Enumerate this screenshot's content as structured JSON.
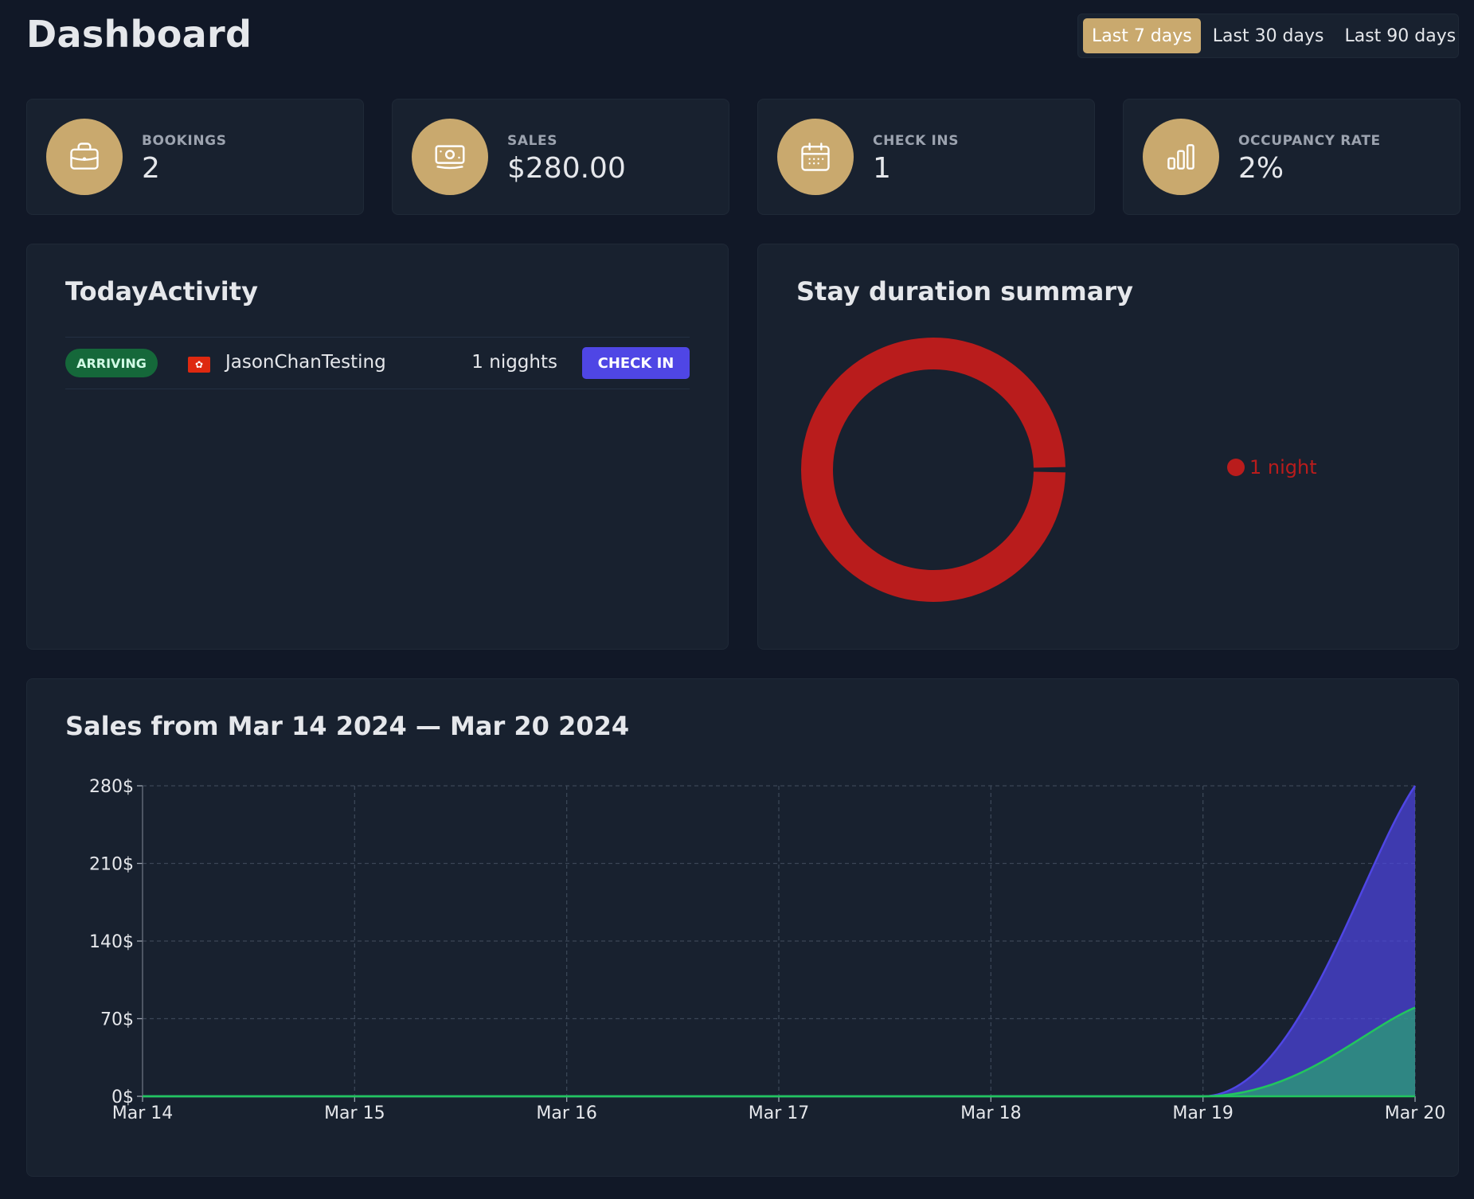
{
  "header": {
    "title": "Dashboard"
  },
  "filters": [
    {
      "label": "Last 7 days",
      "active": true
    },
    {
      "label": "Last 30 days",
      "active": false
    },
    {
      "label": "Last 90 days",
      "active": false
    }
  ],
  "stats": [
    {
      "label": "Bookings",
      "value": "2",
      "icon": "briefcase-icon"
    },
    {
      "label": "Sales",
      "value": "$280.00",
      "icon": "banknotes-icon"
    },
    {
      "label": "Check ins",
      "value": "1",
      "icon": "calendar-icon"
    },
    {
      "label": "Occupancy rate",
      "value": "2%",
      "icon": "chart-bar-icon"
    }
  ],
  "today": {
    "title": "TodayActivity",
    "rows": [
      {
        "status": "Arriving",
        "flag_icon": "hong-kong-flag-icon",
        "guest": "JasonChanTesting",
        "nights": "1 nigghts",
        "action": "Check in"
      }
    ]
  },
  "stay": {
    "title": "Stay duration summary",
    "legend": "1 night"
  },
  "sales": {
    "title": "Sales from Mar 14 2024 — Mar 20 2024"
  },
  "colors": {
    "accent": "#c9a96e",
    "background": "#111827",
    "panel": "#18212f",
    "donut": "#b91c1c",
    "total_sales": "#4f46e5",
    "extras_sales": "#22c55e",
    "button": "#4f46e5",
    "badge": "#15683a"
  },
  "chart_data": [
    {
      "type": "pie",
      "categories": [
        "1 night"
      ],
      "values": [
        1
      ],
      "title": "Stay duration summary",
      "legend": "right"
    },
    {
      "type": "area",
      "title": "Sales from Mar 14 2024 — Mar 20 2024",
      "categories": [
        "Mar 14",
        "Mar 15",
        "Mar 16",
        "Mar 17",
        "Mar 18",
        "Mar 19",
        "Mar 20"
      ],
      "series": [
        {
          "values": [
            0,
            0,
            0,
            0,
            0,
            0,
            280
          ],
          "color": "#4f46e5"
        },
        {
          "values": [
            0,
            0,
            0,
            0,
            0,
            0,
            80
          ],
          "color": "#22c55e"
        }
      ],
      "ylim": [
        0,
        280
      ],
      "yticks": [
        "0$",
        "70$",
        "140$",
        "210$",
        "280$"
      ],
      "grid": true
    }
  ]
}
